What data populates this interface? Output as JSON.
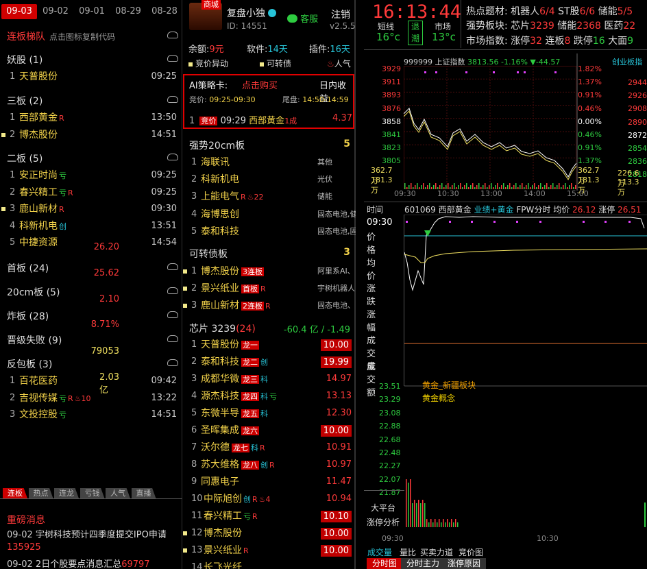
{
  "left": {
    "dates": [
      "09-03",
      "09-02",
      "09-01",
      "08-29",
      "08-28"
    ],
    "title": "连板梯队",
    "subtitle": "点击图标复制代码",
    "groups": [
      {
        "name": "妖股 (1)",
        "rows": [
          {
            "n": "1",
            "name": "天普股份",
            "tags": [],
            "time": "09:25"
          }
        ]
      },
      {
        "name": "三板 (2)",
        "rows": [
          {
            "n": "1",
            "name": "西部黄金",
            "tags": [
              {
                "t": "R",
                "c": "red"
              }
            ],
            "time": "13:50"
          },
          {
            "n": "2",
            "name": "博杰股份",
            "tags": [],
            "time": "14:51",
            "sq": true
          }
        ]
      },
      {
        "name": "二板 (5)",
        "rows": [
          {
            "n": "1",
            "name": "安正时尚",
            "tags": [
              {
                "t": "亏",
                "c": "grn"
              }
            ],
            "time": "09:25"
          },
          {
            "n": "2",
            "name": "春兴精工",
            "tags": [
              {
                "t": "亏",
                "c": "grn"
              },
              {
                "t": "R",
                "c": "red"
              }
            ],
            "time": "09:25"
          },
          {
            "n": "3",
            "name": "鹿山新材",
            "tags": [
              {
                "t": "R",
                "c": "red"
              }
            ],
            "time": "09:30",
            "sq": true
          },
          {
            "n": "4",
            "name": "科新机电",
            "tags": [
              {
                "t": "创",
                "c": "cy"
              }
            ],
            "time": "13:51"
          },
          {
            "n": "5",
            "name": "中捷资源",
            "tags": [],
            "time": "14:54"
          }
        ]
      },
      {
        "name": "首板 (24)",
        "rows": []
      },
      {
        "name": "20cm板 (5)",
        "rows": []
      },
      {
        "name": "炸板 (28)",
        "rows": []
      },
      {
        "name": "晋级失败 (9)",
        "rows": []
      },
      {
        "name": "反包板 (3)",
        "rows": [
          {
            "n": "1",
            "name": "百花医药",
            "tags": [],
            "time": "09:42"
          },
          {
            "n": "2",
            "name": "吉视传媒",
            "tags": [
              {
                "t": "亏",
                "c": "grn"
              },
              {
                "t": "R",
                "c": "red"
              },
              {
                "t": "♨10",
                "c": "red"
              }
            ],
            "time": "13:22"
          },
          {
            "n": "3",
            "name": "文投控股",
            "tags": [
              {
                "t": "亏",
                "c": "grn"
              }
            ],
            "time": "14:51"
          }
        ]
      }
    ],
    "btabs": [
      "连板",
      "热点",
      "连龙",
      "亏钱",
      "人气",
      "直播"
    ],
    "news_title": "重磅消息",
    "news": [
      {
        "date": "09-02",
        "text": "宇树科技预计四季度提交IPO申请",
        "num": "135925"
      },
      {
        "date": "09-02",
        "text": "2日个股要点消息汇总",
        "num": "69797"
      }
    ]
  },
  "mid": {
    "badge": "商城",
    "user": "复盘小独",
    "id": "ID: 14551",
    "kefu": "客服",
    "logout": "注销",
    "ver": "v2.5.5",
    "balance_l": "余额:",
    "balance": "9元",
    "soft_l": "软件:",
    "soft": "14天",
    "plug_l": "插件:",
    "plug": "16天",
    "opts": [
      "竞价异动",
      "可转债",
      "人气"
    ],
    "ai": {
      "title": "AI策略卡:",
      "buy": "点击购买",
      "right": "日内收益",
      "bid_l": "竞价:",
      "bid": "09:25-09:30",
      "tail_l": "尾盘:",
      "tail": "14:50-14:59",
      "n": "1",
      "tag": "竞价",
      "time": "09:29",
      "name": "西部黄金",
      "tag2": "1成",
      "val": "4.37"
    },
    "s20": {
      "title": "强势20cm板",
      "count": "5",
      "rows": [
        {
          "n": "1",
          "name": "海联讯",
          "tags": [],
          "cat": "其他"
        },
        {
          "n": "2",
          "name": "科新机电",
          "tags": [],
          "cat": "光伏"
        },
        {
          "n": "3",
          "name": "上能电气",
          "tags": [
            {
              "t": "R",
              "c": "red"
            },
            {
              "t": "♨22",
              "c": "red"
            }
          ],
          "cat": "储能"
        },
        {
          "n": "4",
          "name": "海博思创",
          "tags": [],
          "cat": "固态电池,储"
        },
        {
          "n": "5",
          "name": "泰和科技",
          "tags": [],
          "cat": "固态电池,固"
        }
      ]
    },
    "kzz": {
      "title": "可转债板",
      "count": "3",
      "rows": [
        {
          "n": "1",
          "name": "博杰股份",
          "lt": "3连板",
          "tags": [],
          "cat": "阿里系AI、"
        },
        {
          "n": "2",
          "name": "景兴纸业",
          "lt": "首板",
          "tags": [
            {
              "t": "R",
              "c": "red"
            }
          ],
          "cat": "宇树机器人"
        },
        {
          "n": "3",
          "name": "鹿山新材",
          "lt": "2连板",
          "tags": [
            {
              "t": "R",
              "c": "red"
            }
          ],
          "cat": "固态电池、"
        }
      ]
    },
    "chip": {
      "title": "芯片 3239",
      "count": "(24)",
      "amt": "-60.4 亿",
      "pct": "-1.49",
      "rows": [
        {
          "n": "1",
          "name": "天普股份",
          "lt": "龙一",
          "tags": [],
          "v": "10.00",
          "box": true
        },
        {
          "n": "2",
          "name": "泰和科技",
          "lt": "龙二",
          "tags": [
            {
              "t": "创",
              "c": "cy"
            }
          ],
          "v": "19.99",
          "box": true
        },
        {
          "n": "3",
          "name": "成都华微",
          "lt": "龙三",
          "tags": [
            {
              "t": "科",
              "c": "cy"
            }
          ],
          "v": "14.97"
        },
        {
          "n": "4",
          "name": "源杰科技",
          "lt": "龙四",
          "tags": [
            {
              "t": "科",
              "c": "cy"
            },
            {
              "t": "亏",
              "c": "grn"
            }
          ],
          "v": "13.13"
        },
        {
          "n": "5",
          "name": "东微半导",
          "lt": "龙五",
          "tags": [
            {
              "t": "科",
              "c": "cy"
            }
          ],
          "v": "12.30"
        },
        {
          "n": "6",
          "name": "圣晖集成",
          "lt": "龙六",
          "tags": [],
          "v": "10.00",
          "box": true
        },
        {
          "n": "7",
          "name": "沃尔德",
          "lt": "龙七",
          "tags": [
            {
              "t": "科",
              "c": "cy"
            },
            {
              "t": "R",
              "c": "red"
            }
          ],
          "v": "10.91"
        },
        {
          "n": "8",
          "name": "苏大维格",
          "lt": "龙八",
          "tags": [
            {
              "t": "创",
              "c": "cy"
            },
            {
              "t": "R",
              "c": "red"
            }
          ],
          "v": "10.97"
        },
        {
          "n": "9",
          "name": "同惠电子",
          "lt": "",
          "tags": [],
          "v": "11.47"
        },
        {
          "n": "10",
          "name": "中际旭创",
          "lt": "",
          "tags": [
            {
              "t": "创",
              "c": "cy"
            },
            {
              "t": "R",
              "c": "red"
            },
            {
              "t": "♨4",
              "c": "red"
            }
          ],
          "v": "10.94"
        },
        {
          "n": "11",
          "name": "春兴精工",
          "lt": "",
          "tags": [
            {
              "t": "亏",
              "c": "grn"
            },
            {
              "t": "R",
              "c": "red"
            }
          ],
          "v": "10.10",
          "box": true
        },
        {
          "n": "12",
          "name": "博杰股份",
          "lt": "",
          "tags": [],
          "v": "10.00",
          "box": true,
          "sq": true
        },
        {
          "n": "13",
          "name": "景兴纸业",
          "lt": "",
          "tags": [
            {
              "t": "R",
              "c": "red"
            }
          ],
          "v": "10.00",
          "box": true,
          "sq": true
        },
        {
          "n": "14",
          "name": "长飞光纤",
          "lt": "",
          "tags": [],
          "v": ""
        }
      ]
    }
  },
  "right": {
    "time": "16:13:44",
    "short_l": "短线",
    "short_v": "16°c",
    "tui": "退",
    "chao": "潮",
    "mkt_l": "市场",
    "mkt_v": "13°c",
    "hot_l": "热点题材:",
    "hot": [
      {
        "n": "机器人",
        "v": "6/4"
      },
      {
        "n": "ST股",
        "v": "6/6"
      },
      {
        "n": "储能",
        "v": "5/5"
      }
    ],
    "strong_l": "强势板块:",
    "strong": [
      {
        "n": "芯片",
        "v": "3239"
      },
      {
        "n": "储能",
        "v": "2368"
      },
      {
        "n": "医药",
        "v": "22"
      }
    ],
    "idx_l": "市场指数:",
    "idx": [
      {
        "n": "涨停",
        "v": "32"
      },
      {
        "n": "连板",
        "v": "8"
      },
      {
        "n": "跌停",
        "v": "16"
      },
      {
        "n": "大面",
        "v": "9"
      }
    ],
    "sh": {
      "code": "999999",
      "name": "上证指数",
      "price": "3813.56",
      "pct": "-1.16%",
      "chg": "▼-44.57",
      "side": "创业板指",
      "yl": [
        "3929",
        "3911",
        "3893",
        "3876",
        "3858",
        "3841",
        "3823",
        "3805"
      ],
      "yr": [
        "1.82%",
        "1.37%",
        "0.91%",
        "0.46%",
        "0.00%",
        "0.46%",
        "0.91%",
        "1.37%"
      ],
      "vl": "362.7万",
      "vl2": "181.3万",
      "vr": "362.7万",
      "vr2": "181.3万",
      "side_y": [
        "2944",
        "2926",
        "2908",
        "2890",
        "2872",
        "2854",
        "2836",
        "2818"
      ],
      "side_v": "226.6万",
      "side_v2": "113.3万",
      "x": [
        "09:30",
        "10:30",
        "13:00",
        "14:00",
        "15:00"
      ]
    },
    "st": {
      "tlabel": "时间",
      "code": "601069",
      "name": "西部黄金",
      "biz": "业绩+黄金",
      "fpw": "FPW分时",
      "avg_l": "均价",
      "avg": "26.12",
      "zt_l": "涨停",
      "zt": "26.51",
      "tv": "09:30",
      "lp_l": "价格",
      "lp": "26.20",
      "la_l": "均价",
      "la": "25.62",
      "lz_l": "涨跌",
      "lz": "2.10",
      "lf_l": "涨幅",
      "lf": "8.71%",
      "lc_l": "成交量",
      "lc": "79053",
      "le_l": "成交额",
      "le": "2.03亿",
      "ann1": "黄金_新疆板块",
      "ann2": "黄金概念",
      "scale": [
        "23.51",
        "23.29",
        "23.08",
        "22.88",
        "22.68",
        "22.48",
        "22.27",
        "22.07",
        "21.87"
      ],
      "dpt": "大平台",
      "dzt": "涨停分析",
      "x": [
        "09:30",
        "10:30"
      ],
      "tabs1": [
        "成交量",
        "量比",
        "买卖力道",
        "竞价图"
      ],
      "tabs2": [
        "分时图",
        "分时主力",
        "涨停原因"
      ]
    }
  }
}
